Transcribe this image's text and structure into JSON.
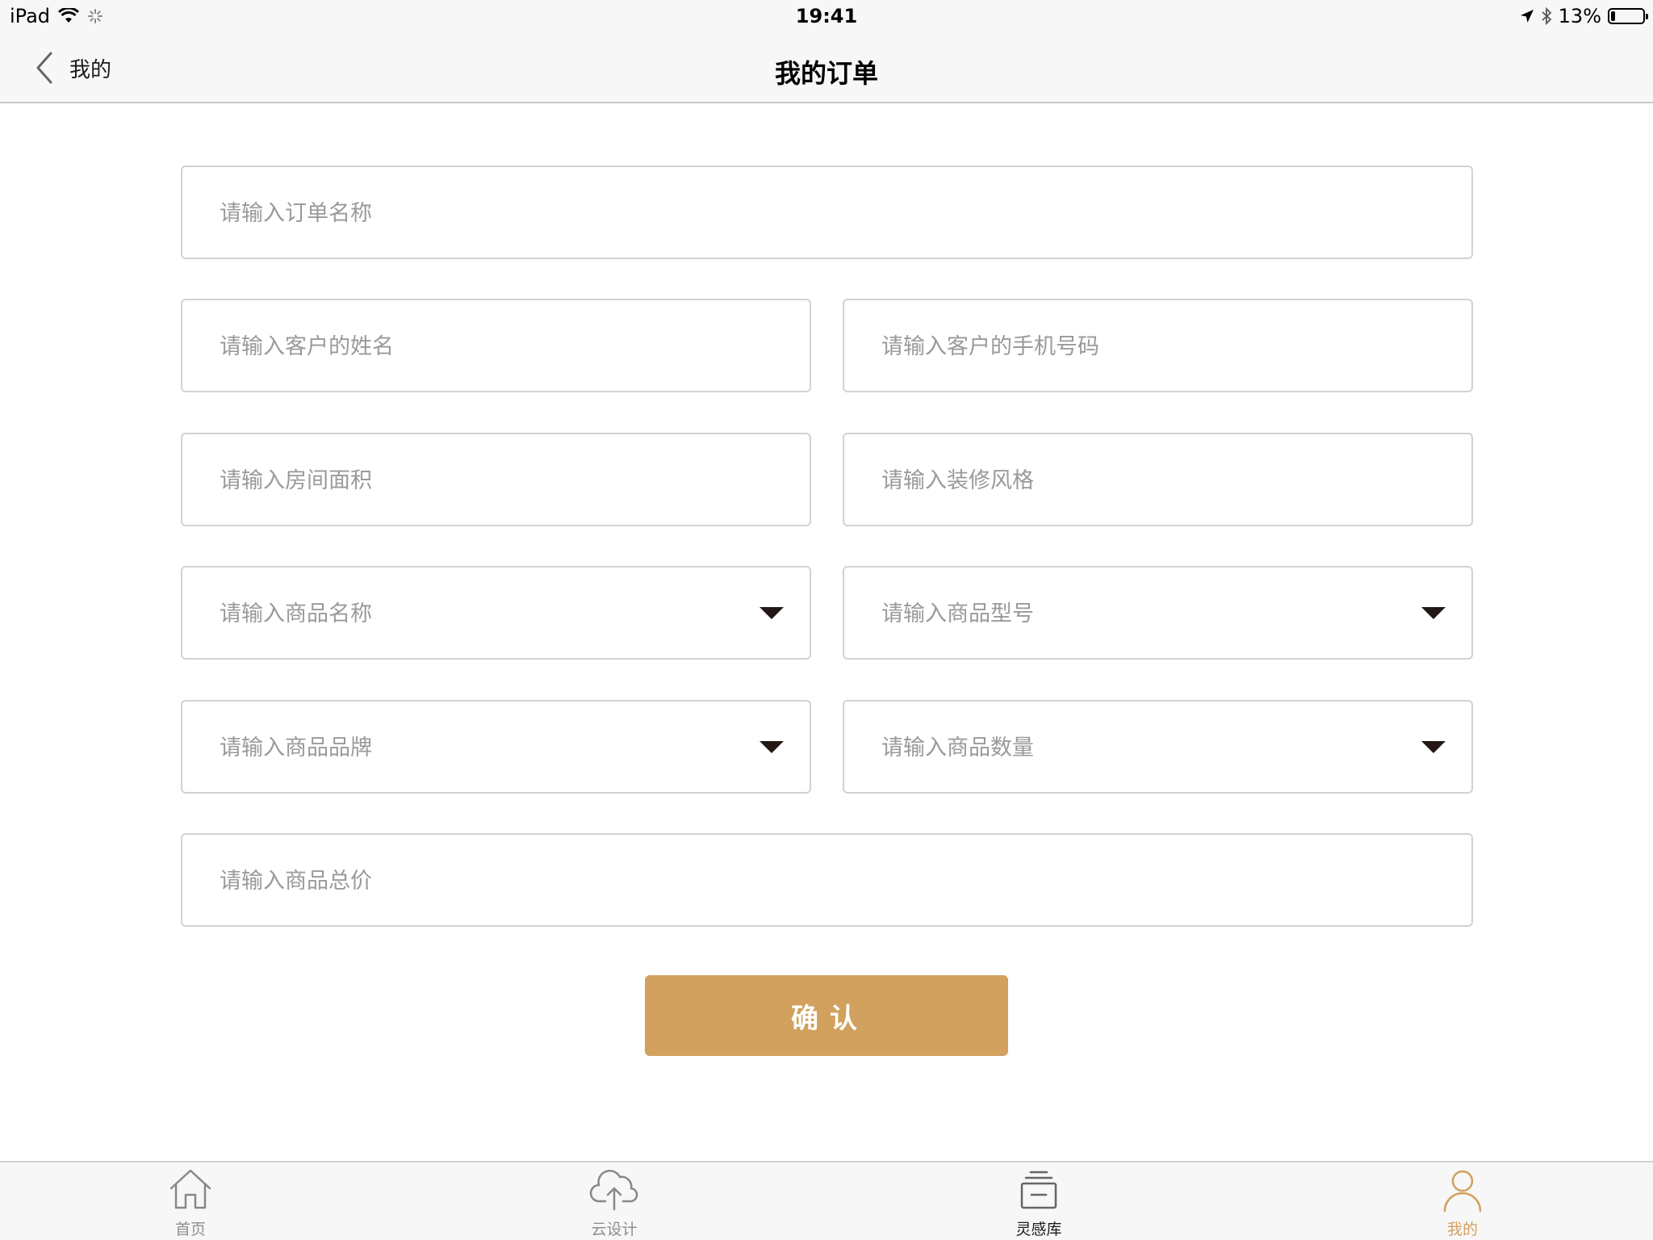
{
  "status_bar": {
    "device": "iPad",
    "time": "19:41",
    "battery": "13%",
    "battery_level": 0.13
  },
  "nav": {
    "back_label": "我的",
    "title": "我的订单"
  },
  "form": {
    "order_name_placeholder": "请输入订单名称",
    "customer_name_placeholder": "请输入客户的姓名",
    "customer_phone_placeholder": "请输入客户的手机号码",
    "room_area_placeholder": "请输入房间面积",
    "decor_style_placeholder": "请输入装修风格",
    "product_name_placeholder": "请输入商品名称",
    "product_model_placeholder": "请输入商品型号",
    "product_brand_placeholder": "请输入商品品牌",
    "product_quantity_placeholder": "请输入商品数量",
    "product_total_placeholder": "请输入商品总价",
    "confirm_label": "确认"
  },
  "tab_bar": {
    "home": "首页",
    "cloud_design": "云设计",
    "inspiration": "灵感库",
    "mine": "我的"
  },
  "colors": {
    "accent": "#d1a15d",
    "border": "#d2d2d2",
    "placeholder": "#9a9a9a",
    "bar_background": "#f7f7f7"
  }
}
